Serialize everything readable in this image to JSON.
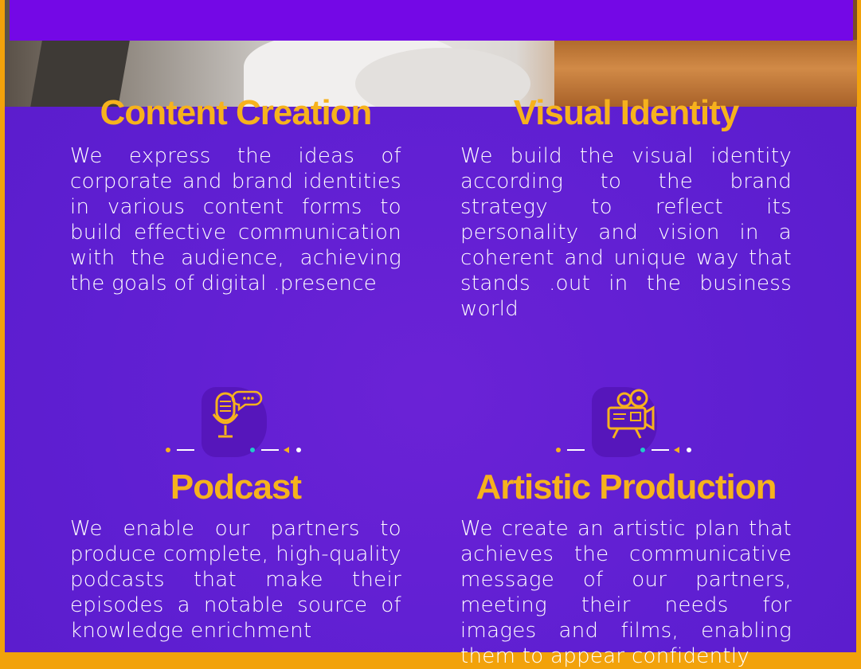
{
  "services": [
    {
      "title": "Content Creation",
      "description": "We express the ideas of corporate and brand identities in various content forms to build effective communication with the audience, achieving the goals of digital .presence"
    },
    {
      "title": "Visual Identity",
      "description": "We build the visual identity according to the brand strategy to reflect its personality and vision in a coherent and unique way that stands .out in the business world"
    },
    {
      "title": "Podcast",
      "icon": "microphone-icon",
      "description": "We enable our partners to produce complete, high-quality podcasts that make their episodes a notable source of knowledge enrichment"
    },
    {
      "title": "Artistic Production",
      "icon": "film-camera-icon",
      "description": "We create an artistic plan that achieves the communicative message of our partners, meeting their needs for images and films, enabling them to appear confidently"
    }
  ],
  "colors": {
    "accent": "#f6b21d",
    "background": "#5f1fd2",
    "header": "#7408e6",
    "teal": "#22c9c9"
  }
}
